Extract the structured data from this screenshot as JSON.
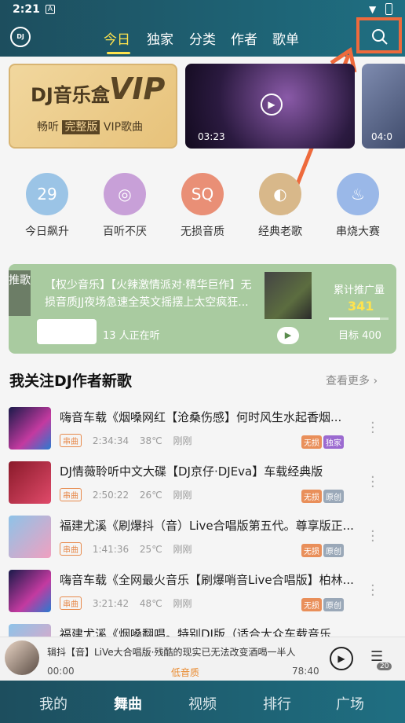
{
  "status_bar": {
    "time": "2:21"
  },
  "header": {
    "logo_text": "DJ",
    "tabs": [
      "今日",
      "独家",
      "分类",
      "作者",
      "歌单"
    ],
    "active_tab": 0
  },
  "banners": {
    "vip": {
      "title": "DJ音乐盒",
      "big": "VIP",
      "sub_prefix": "畅听",
      "sub_highlight": "完整版",
      "sub_suffix": "VIP歌曲"
    },
    "video_1_duration": "03:23",
    "video_2_duration": "04:0"
  },
  "categories": [
    {
      "label": "今日飙升",
      "icon_text": "29",
      "color": "#9bc4e6",
      "icon": "calendar-icon"
    },
    {
      "label": "百听不厌",
      "icon_text": "◎",
      "color": "#c8a0d8",
      "icon": "disc-icon"
    },
    {
      "label": "无损音质",
      "icon_text": "SQ",
      "color": "#e98f76",
      "icon": "headphones-icon"
    },
    {
      "label": "经典老歌",
      "icon_text": "◐",
      "color": "#d8b88a",
      "icon": "shell-icon"
    },
    {
      "label": "串烧大赛",
      "icon_text": "♨",
      "color": "#9ab8e8",
      "icon": "flame-icon"
    }
  ],
  "recommend": {
    "side_label": "推歌",
    "text": "【权少音乐】【火辣激情派对·精华巨作】无损音质JJ夜场急速全英文摇摆上太空疯狂...",
    "listeners": "13 人正在听",
    "stat_label": "累计推广量",
    "stat_value": "341",
    "stat_fraction": 0.8525,
    "goal": "目标 400"
  },
  "section": {
    "title": "我关注DJ作者新歌",
    "more": "查看更多 ›"
  },
  "songs": [
    {
      "title": "嗨音车载《烟嗓网红【沧桑伤感】何时风生水起香烟...",
      "type": "串曲",
      "duration": "2:34:34",
      "temp": "38℃",
      "time": "刚刚",
      "badges": [
        "无损",
        "独家"
      ],
      "thumb": "dark-blue"
    },
    {
      "title": "DJ情薇聆听中文大碟【DJ京仔·DJEva】车载经典版",
      "type": "串曲",
      "duration": "2:50:22",
      "temp": "26℃",
      "time": "刚刚",
      "badges": [
        "无损",
        "原创"
      ],
      "thumb": "red"
    },
    {
      "title": "福建尤溪《刷爆抖（音）Live合唱版第五代。尊享版正...",
      "type": "串曲",
      "duration": "1:41:36",
      "temp": "25℃",
      "time": "刚刚",
      "badges": [
        "无损",
        "原创"
      ],
      "thumb": "sky"
    },
    {
      "title": "嗨音车载《全网最火音乐【刷爆哨音Live合唱版】柏林...",
      "type": "串曲",
      "duration": "3:21:42",
      "temp": "48℃",
      "time": "刚刚",
      "badges": [
        "无损",
        "原创"
      ],
      "thumb": "dark-blue"
    },
    {
      "title": "福建尤溪《烟嗓翻唱。特别DJ版（适合大众车载音乐...",
      "type": "",
      "duration": "",
      "temp": "",
      "time": "",
      "badges": [],
      "thumb": "sky"
    }
  ],
  "player": {
    "title": "辑抖【音】LiVe大合唱版·残酷的现实已无法改变酒喝一半人",
    "time_current": "00:00",
    "quality": "低音质",
    "time_total": "78:40",
    "playlist_count": "20"
  },
  "bottom_nav": [
    "我的",
    "舞曲",
    "视频",
    "排行",
    "广场"
  ],
  "bottom_nav_active": 1,
  "colors": {
    "accent": "#ffe34d",
    "header": "#1d4e5e",
    "annotation": "#ee6a3c"
  }
}
